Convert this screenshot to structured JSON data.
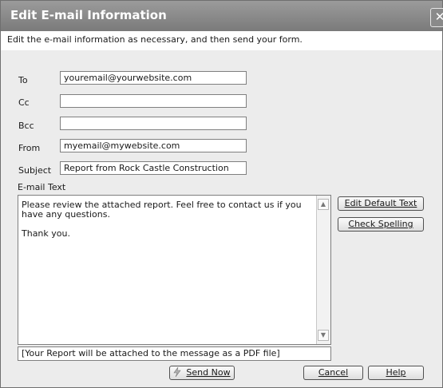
{
  "window": {
    "title": "Edit E-mail Information",
    "close_glyph": "✕"
  },
  "instruction": "Edit the e-mail information as necessary, and then send your form.",
  "fields": [
    {
      "label": "To",
      "value": "youremail@yourwebsite.com"
    },
    {
      "label": "Cc",
      "value": ""
    },
    {
      "label": "Bcc",
      "value": ""
    },
    {
      "label": "From",
      "value": "myemail@mywebsite.com"
    },
    {
      "label": "Subject",
      "value": "Report from Rock Castle Construction"
    }
  ],
  "email_text": {
    "label": "E-mail Text",
    "line1": "Please review the attached report.  Feel free to contact us if you have any questions.",
    "line2": "Thank you."
  },
  "attachment_note": "[Your Report will be attached to the message as a PDF file]",
  "buttons": {
    "edit_default_text": "Edit Default Text",
    "check_spelling": "Check Spelling",
    "send_now": "Send Now",
    "cancel": "Cancel",
    "help": "Help"
  },
  "icons": {
    "send": "lightning-icon",
    "scroll_up": "scroll-up-arrow-icon",
    "scroll_down": "scroll-down-arrow-icon"
  }
}
